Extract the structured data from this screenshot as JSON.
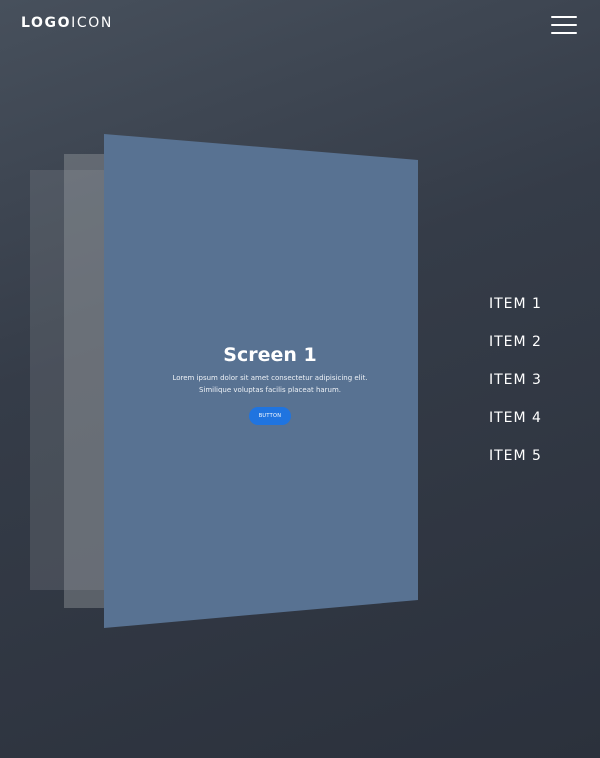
{
  "header": {
    "logo_bold": "LOGO",
    "logo_light": "ICON",
    "menu_icon": "hamburger-menu-icon"
  },
  "screen": {
    "title": "Screen 1",
    "text_line1": "Lorem ipsum dolor sit amet consectetur adipisicing elit.",
    "text_line2": "Similique voluptas facilis placeat harum.",
    "button_label": "BUTTON"
  },
  "nav": {
    "items": [
      {
        "label": "ITEM 1"
      },
      {
        "label": "ITEM 2"
      },
      {
        "label": "ITEM 3"
      },
      {
        "label": "ITEM 4"
      },
      {
        "label": "ITEM 5"
      }
    ]
  },
  "colors": {
    "background_top": "#47505c",
    "background_bottom": "#2b313c",
    "panel_front": "#587292",
    "button": "#1f74e0",
    "text": "#ffffff"
  }
}
